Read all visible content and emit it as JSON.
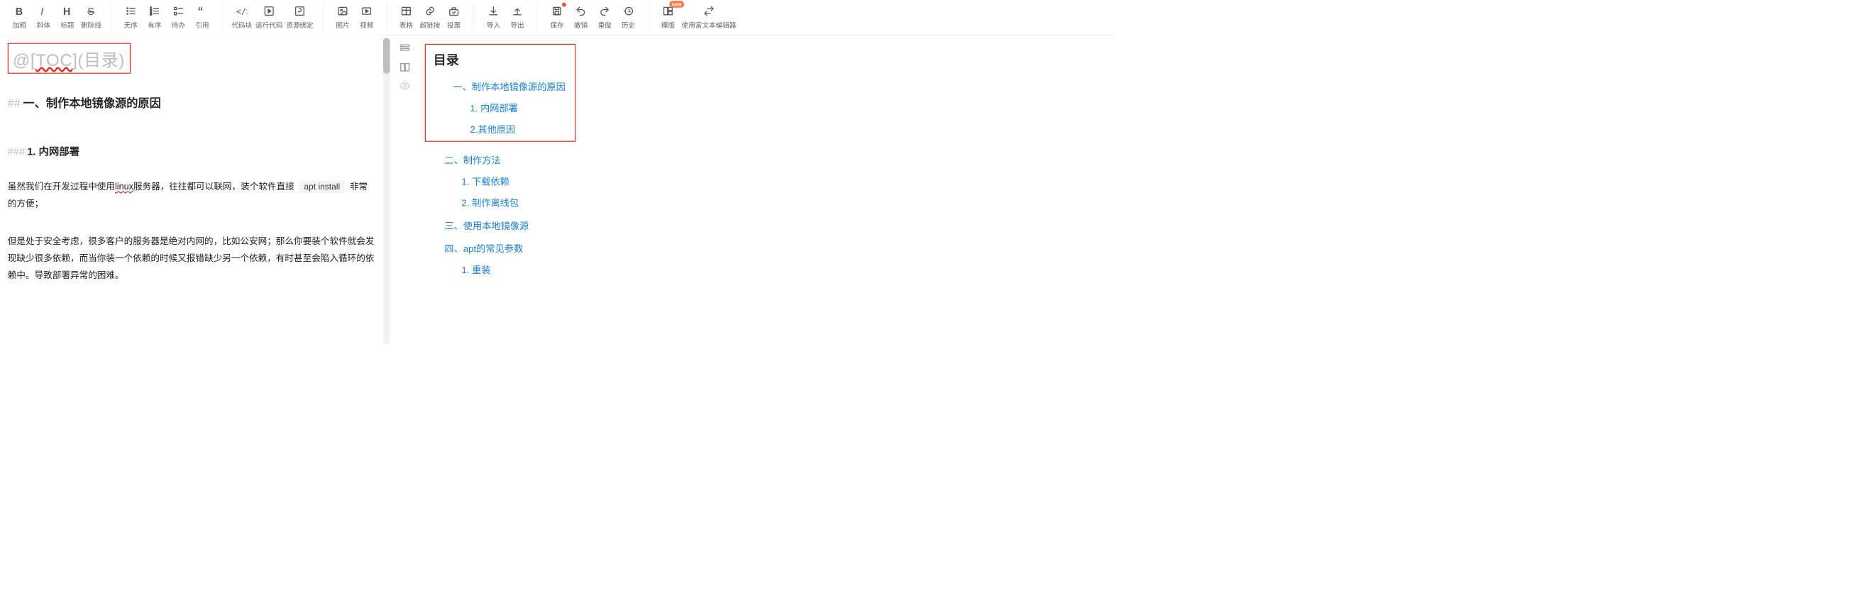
{
  "toolbar": {
    "groups": [
      {
        "items": [
          {
            "id": "bold",
            "label": "加粗",
            "icon": "bold"
          },
          {
            "id": "italic",
            "label": "斜体",
            "icon": "italic"
          },
          {
            "id": "heading",
            "label": "标题",
            "icon": "heading"
          },
          {
            "id": "strike",
            "label": "删除线",
            "icon": "strike"
          }
        ]
      },
      {
        "items": [
          {
            "id": "ul",
            "label": "无序",
            "icon": "list-ul"
          },
          {
            "id": "ol",
            "label": "有序",
            "icon": "list-ol"
          },
          {
            "id": "todo",
            "label": "待办",
            "icon": "list-check"
          },
          {
            "id": "quote",
            "label": "引用",
            "icon": "quote"
          }
        ]
      },
      {
        "items": [
          {
            "id": "codeblock",
            "label": "代码块",
            "icon": "braces"
          },
          {
            "id": "runcode",
            "label": "运行代码",
            "icon": "play-box"
          },
          {
            "id": "resource",
            "label": "资源绑定",
            "icon": "link-box"
          }
        ]
      },
      {
        "items": [
          {
            "id": "image",
            "label": "图片",
            "icon": "image"
          },
          {
            "id": "video",
            "label": "视频",
            "icon": "video"
          }
        ]
      },
      {
        "items": [
          {
            "id": "table",
            "label": "表格",
            "icon": "table"
          },
          {
            "id": "link",
            "label": "超链接",
            "icon": "link"
          },
          {
            "id": "vote",
            "label": "投票",
            "icon": "vote"
          }
        ]
      },
      {
        "items": [
          {
            "id": "import",
            "label": "导入",
            "icon": "download"
          },
          {
            "id": "export",
            "label": "导出",
            "icon": "upload"
          }
        ]
      },
      {
        "items": [
          {
            "id": "save",
            "label": "保存",
            "icon": "save",
            "dot": true
          },
          {
            "id": "undo",
            "label": "撤销",
            "icon": "undo"
          },
          {
            "id": "redo",
            "label": "重做",
            "icon": "redo"
          },
          {
            "id": "history",
            "label": "历史",
            "icon": "history"
          }
        ]
      },
      {
        "items": [
          {
            "id": "template",
            "label": "模版",
            "icon": "template",
            "badge": "new"
          },
          {
            "id": "richtext",
            "label": "使用富文本编辑器",
            "icon": "switch"
          }
        ]
      }
    ]
  },
  "editor": {
    "toc_line": "@[TOC](目录)",
    "h2_hash": "##",
    "h2_text": "一、制作本地镜像源的原因",
    "h3_hash": "###",
    "h3_text": "1. 内网部署",
    "p1_pre": "虽然我们在开发过程中使用",
    "p1_sq": "linux",
    "p1_mid": "服务器，往往都可以联网，装个软件直接 ",
    "p1_code": "apt install",
    "p1_post": " 非常的方便；",
    "p2": "但是处于安全考虑，很多客户的服务器是绝对内网的，比如公安网；那么你要装个软件就会发现缺少很多依赖，而当你装一个依赖的时候又报错缺少另一个依赖，有时甚至会陷入循环的依赖中。导致部署异常的困难。"
  },
  "toc": {
    "title": "目录",
    "items": [
      {
        "level": 1,
        "text": "一、制作本地镜像源的原因",
        "boxed": true
      },
      {
        "level": 2,
        "text": "1. 内网部署",
        "boxed": true
      },
      {
        "level": 2,
        "text": "2.其他原因",
        "boxed": true
      },
      {
        "level": 1,
        "text": "二、制作方法"
      },
      {
        "level": 2,
        "text": "1. 下载依赖"
      },
      {
        "level": 2,
        "text": "2. 制作离线包"
      },
      {
        "level": 1,
        "text": "三、使用本地镜像源"
      },
      {
        "level": 1,
        "text": "四、apt的常见参数"
      },
      {
        "level": 2,
        "text": "1. 重装"
      }
    ]
  }
}
